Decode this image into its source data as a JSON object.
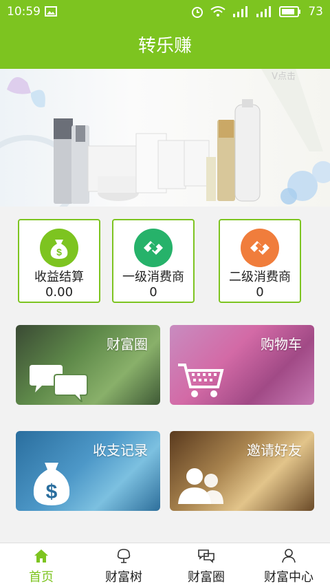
{
  "status_bar": {
    "time": "10:59",
    "battery": "73"
  },
  "header": {
    "title": "转乐赚"
  },
  "banner": {
    "watermark": "V点击"
  },
  "stats": [
    {
      "label": "收益结算",
      "value": "0.00",
      "icon": "money-bag-icon",
      "color": "#7dc420"
    },
    {
      "label": "一级消费商",
      "value": "0",
      "icon": "handshake-icon",
      "color": "#26b26a"
    },
    {
      "label": "二级消费商",
      "value": "0",
      "icon": "handshake-icon",
      "color": "#f07d3c"
    }
  ],
  "tiles": [
    {
      "label": "财富圈",
      "icon": "chat-bubbles-icon"
    },
    {
      "label": "购物车",
      "icon": "shopping-cart-icon"
    },
    {
      "label": "收支记录",
      "icon": "money-bag-icon"
    },
    {
      "label": "邀请好友",
      "icon": "people-icon"
    }
  ],
  "tabs": [
    {
      "label": "首页",
      "icon": "home-icon",
      "active": true
    },
    {
      "label": "财富树",
      "icon": "tree-icon",
      "active": false
    },
    {
      "label": "财富圈",
      "icon": "chat-icon",
      "active": false
    },
    {
      "label": "财富中心",
      "icon": "user-icon",
      "active": false
    }
  ]
}
